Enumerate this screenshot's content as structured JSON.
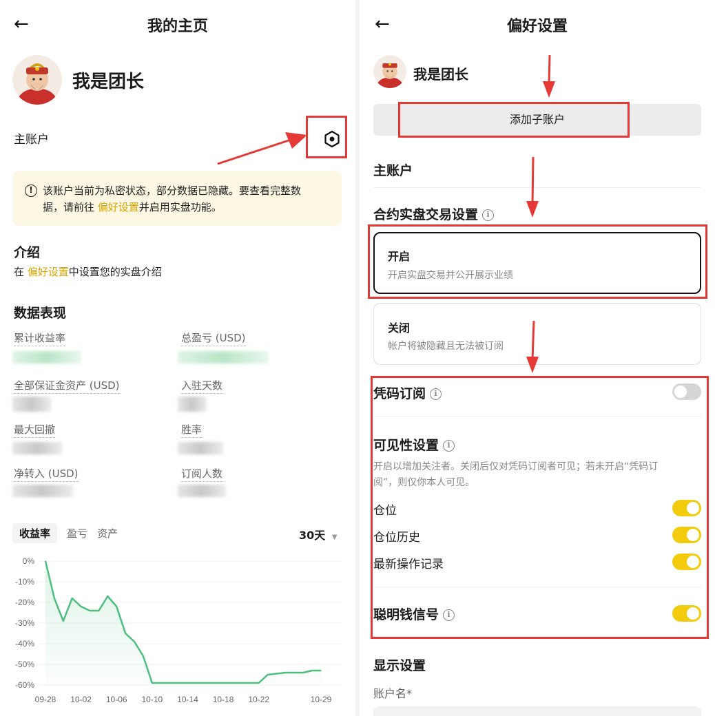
{
  "left": {
    "title": "我的主页",
    "back_icon": "←",
    "user_name": "我是团长",
    "account_label": "主账户",
    "notice": {
      "text_1": "该账户当前为私密状态，部分数据已隐藏。要查看完整数",
      "text_2a": "据，请前往 ",
      "link": "偏好设置",
      "text_2b": "并启用实盘功能。"
    },
    "intro": {
      "title": "介绍",
      "prefix": "在 ",
      "link": "偏好设置",
      "suffix": "中设置您的实盘介绍"
    },
    "data_title": "数据表现",
    "metrics": [
      {
        "label": "累计收益率"
      },
      {
        "label": "总盈亏 (USD)"
      },
      {
        "label": "全部保证金资产 (USD)"
      },
      {
        "label": "入驻天数"
      },
      {
        "label": "最大回撤"
      },
      {
        "label": "胜率"
      },
      {
        "label": "净转入 (USD)"
      },
      {
        "label": "订阅人数"
      }
    ],
    "tabs": [
      "收益率",
      "盈亏",
      "资产"
    ],
    "period": "30天",
    "chart_data": {
      "type": "area",
      "title": "",
      "xlabel": "",
      "ylabel": "",
      "ylim": [
        -60,
        0
      ],
      "yticks": [
        "0%",
        "-10%",
        "-20%",
        "-30%",
        "-40%",
        "-50%",
        "-60%"
      ],
      "xticks": [
        "09-28",
        "10-02",
        "10-06",
        "10-10",
        "10-14",
        "10-18",
        "10-22",
        "10-29"
      ],
      "color": "#4cbf7f",
      "series": [
        {
          "x": [
            "09-28",
            "09-29",
            "09-30",
            "10-01",
            "10-02",
            "10-03",
            "10-04",
            "10-05",
            "10-06",
            "10-07",
            "10-08",
            "10-09",
            "10-10",
            "10-11",
            "10-12",
            "10-13",
            "10-14",
            "10-15",
            "10-16",
            "10-17",
            "10-18",
            "10-19",
            "10-20",
            "10-21",
            "10-22",
            "10-23",
            "10-24",
            "10-25",
            "10-26",
            "10-27",
            "10-28",
            "10-29"
          ],
          "values": [
            0,
            -18,
            -29,
            -18,
            -22,
            -24,
            -24,
            -17,
            -22,
            -35,
            -39,
            -46,
            -59,
            -59,
            -59,
            -59,
            -59,
            -59,
            -59,
            -59,
            -59,
            -59,
            -59,
            -59,
            -59,
            -55,
            -54.5,
            -54,
            -54,
            -54,
            -53,
            -53
          ]
        }
      ]
    }
  },
  "right": {
    "title": "偏好设置",
    "back_icon": "←",
    "user_name": "我是团长",
    "add_sub_account": "添加子账户",
    "main_account": "主账户",
    "contract_title": "合约实盘交易设置",
    "options": [
      {
        "title": "开启",
        "desc": "开启实盘交易并公开展示业绩",
        "selected": true
      },
      {
        "title": "关闭",
        "desc": "帐户将被隐藏且无法被订阅",
        "selected": false
      }
    ],
    "code_sub": {
      "label": "凭码订阅",
      "on": false
    },
    "visibility": {
      "title": "可见性设置",
      "desc_1": "开启以增加关注者。关闭后仅对凭码订阅者可见；若未开启“凭码订",
      "desc_2": "阅”，则仅你本人可见。",
      "items": [
        {
          "label": "仓位",
          "on": true
        },
        {
          "label": "仓位历史",
          "on": true
        },
        {
          "label": "最新操作记录",
          "on": true
        }
      ]
    },
    "smart_money": {
      "label": "聪明钱信号",
      "on": true
    },
    "display_title": "显示设置",
    "account_name_label": "账户名*"
  },
  "colors": {
    "accent": "#d9a400",
    "toggle_on": "#f2cc0c",
    "annotation_red": "#e53935",
    "chart_line": "#4cbf7f"
  }
}
